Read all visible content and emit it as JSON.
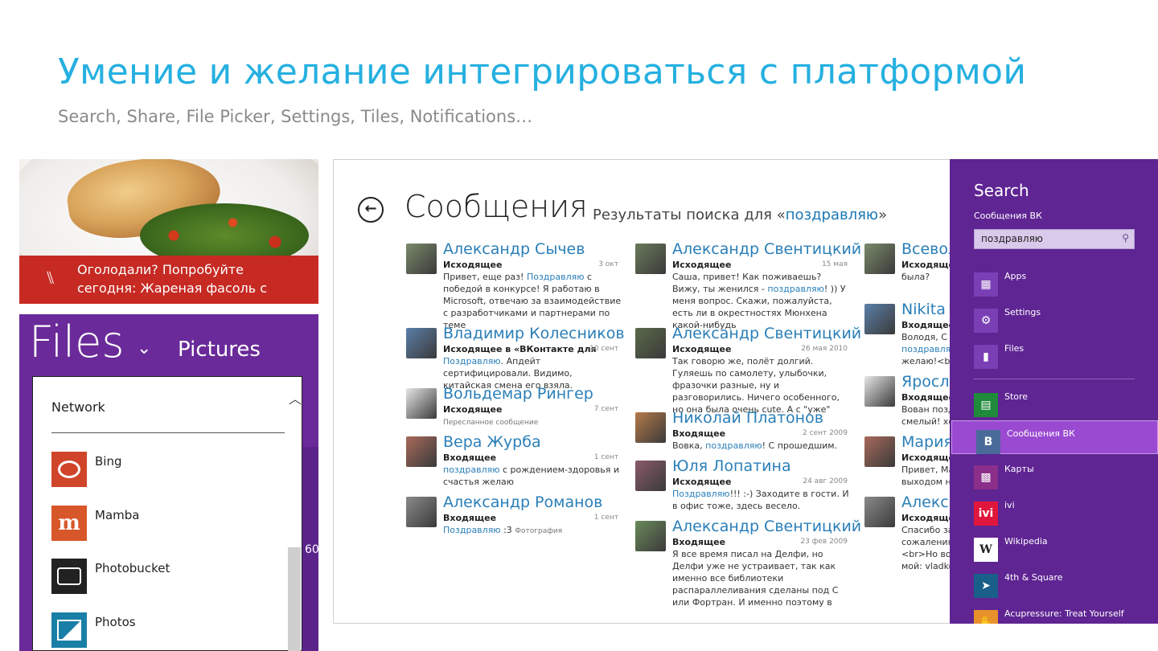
{
  "slide": {
    "title": "Умение и желание интегрироваться с платформой",
    "subtitle": "Search, Share, File Picker, Settings, Tiles, Notifications…"
  },
  "food_tile": {
    "line1": "Оголодали? Попробуйте",
    "line2": "сегодня: Жареная фасоль с",
    "icon": "fork-knife-icon",
    "banner_color": "#c62a23"
  },
  "files_picker": {
    "title": "Files",
    "location": "Pictures",
    "side_number": "60",
    "network_label": "Network",
    "items": [
      {
        "label": "Bing",
        "icon": "bing-icon",
        "glyph": "b",
        "color": "#d0452a"
      },
      {
        "label": "Mamba",
        "icon": "mamba-icon",
        "glyph": "m",
        "color": "#d8572a"
      },
      {
        "label": "Photobucket",
        "icon": "photobucket-icon",
        "glyph": "◙",
        "color": "#222222"
      },
      {
        "label": "Photos",
        "icon": "photos-icon",
        "glyph": "▣",
        "color": "#1a7fa6"
      }
    ]
  },
  "messages": {
    "heading": "Сообщения",
    "results_prefix": "Результаты поиска для «",
    "query": "поздравляю",
    "results_suffix": "»",
    "col1": [
      {
        "name": "Александр Сычев",
        "dir": "Исходящее",
        "date": "3 окт",
        "t1": "Привет, еще раз! ",
        "hl": "Поздравляю",
        "t2": " с победой в конкурсе! Я работаю в Microsoft, отвечаю за взаимодействие с разработчиками и партнерами по теме",
        "small": ""
      },
      {
        "name": "Владимир Колесников",
        "dir": "Исходящее в «ВКонтакте для",
        "date": "10 сент",
        "t1": "",
        "hl": "Поздравляю",
        "t2": ". Апдейт сертифицировали. Видимо, китайская смена его взяла.",
        "small": ""
      },
      {
        "name": "Вольдемар Рингер",
        "dir": "Исходящее",
        "date": "7 сент",
        "t1": "",
        "hl": "",
        "t2": "",
        "small": "Пересланное сообщение"
      },
      {
        "name": "Вера Журба",
        "dir": "Входящее",
        "date": "1 сент",
        "t1": "",
        "hl": "поздравляю",
        "t2": " с рождением-здоровья и счастья желаю",
        "small": ""
      },
      {
        "name": "Александр Романов",
        "dir": "Входящее",
        "date": "1 сент",
        "t1": "",
        "hl": "Поздравляю",
        "t2": " :3 ",
        "small": "Фотография"
      }
    ],
    "col2": [
      {
        "name": "Александр Свентицкий",
        "dir": "Исходящее",
        "date": "15 мая",
        "t1": "Саша, привет! Как поживаешь? Вижу, ты женился - ",
        "hl": "поздравляю",
        "t2": "! )) У меня вопрос. Скажи, пожалуйста, есть ли в окрестностях Мюнхена какой-нибудь",
        "small": ""
      },
      {
        "name": "Александр Свентицкий",
        "dir": "Исходящее",
        "date": "26 мая 2010",
        "t1": "Так говорю же, полёт долгий. Гуляешь по самолету, улыбочки, фразочки разные, ну и разговорились. Ничего особенного, но она была очень cute. А с \"уже\"",
        "hl": "",
        "t2": "",
        "small": ""
      },
      {
        "name": "Николай Платонов",
        "dir": "Входящее",
        "date": "2 сент 2009",
        "t1": "Вовка, ",
        "hl": "поздравляю",
        "t2": "! С прошедшим.",
        "small": ""
      },
      {
        "name": "Юля Лопатина",
        "dir": "Исходящее",
        "date": "24 авг 2009",
        "t1": "",
        "hl": "Поздравляю",
        "t2": "!!! :-) Заходите в гости. И в офис тоже, здесь весело.",
        "small": ""
      },
      {
        "name": "Александр Свентицкий",
        "dir": "Входящее",
        "date": "23 фев 2009",
        "t1": "Я все время писал на Делфи, но Делфи уже не устраивает, так как именно все библиотеки распараллеливания сделаны под С или Фортран. И именно поэтому в",
        "hl": "",
        "t2": "",
        "small": ""
      }
    ],
    "col3": [
      {
        "name": "Всевол",
        "dir": "Исходящее",
        "t1": "",
        "hl": "",
        "t2": "",
        "l1": "",
        "l2": "была?",
        "l3": ""
      },
      {
        "name": "Nikita N",
        "dir": "Входящее",
        "l1": "Володя, С Д",
        "l2": "поздравляю",
        "l3": "желаю!<br>"
      },
      {
        "name": "Яросла",
        "dir": "Входящее",
        "l1": "Вован позд",
        "l2": "смелый! хех",
        "l3": ""
      },
      {
        "name": "Мария",
        "dir": "Исходящее",
        "l1": "Привет, Ма",
        "l2": "выходом на",
        "l3": ""
      },
      {
        "name": "Алекса",
        "dir": "Исходящее",
        "l1": "Спасибо за",
        "l2": "сожалению",
        "l3": "<br>Но вос",
        "l4": "мой: vladkol"
      }
    ]
  },
  "search_charm": {
    "title": "Search",
    "scope": "Сообщения ВК",
    "query": "поздравляю",
    "search_icon": "magnifier-icon",
    "apps_primary": [
      {
        "label": "Apps",
        "icon": "apps-icon",
        "glyph": "▦",
        "color": "#7b3fb5"
      },
      {
        "label": "Settings",
        "icon": "settings-gear-icon",
        "glyph": "⚙",
        "color": "#7b3fb5"
      },
      {
        "label": "Files",
        "icon": "files-icon",
        "glyph": "▮",
        "color": "#7b3fb5"
      }
    ],
    "apps_list": [
      {
        "label": "Store",
        "icon": "store-icon",
        "glyph": "▤",
        "color": "#1e8a3a"
      },
      {
        "label": "Сообщения ВК",
        "icon": "vk-icon",
        "glyph": "B",
        "color": "#4a6b9a"
      },
      {
        "label": "Карты",
        "icon": "maps-icon",
        "glyph": "▩",
        "color": "#8b2f8a"
      },
      {
        "label": "ivi",
        "icon": "ivi-icon",
        "glyph": "ivi",
        "color": "#e0163c"
      },
      {
        "label": "Wikipedia",
        "icon": "wikipedia-icon",
        "glyph": "W",
        "color": "#ffffff"
      },
      {
        "label": "4th & Square",
        "icon": "4th-square-icon",
        "glyph": "➤",
        "color": "#1a5f8a"
      },
      {
        "label": "Acupressure: Treat Yourself",
        "icon": "acupressure-icon",
        "glyph": "✋",
        "color": "#e8912a"
      }
    ],
    "bg_color": "#5f2593",
    "selected_color": "#9a4ad1"
  }
}
